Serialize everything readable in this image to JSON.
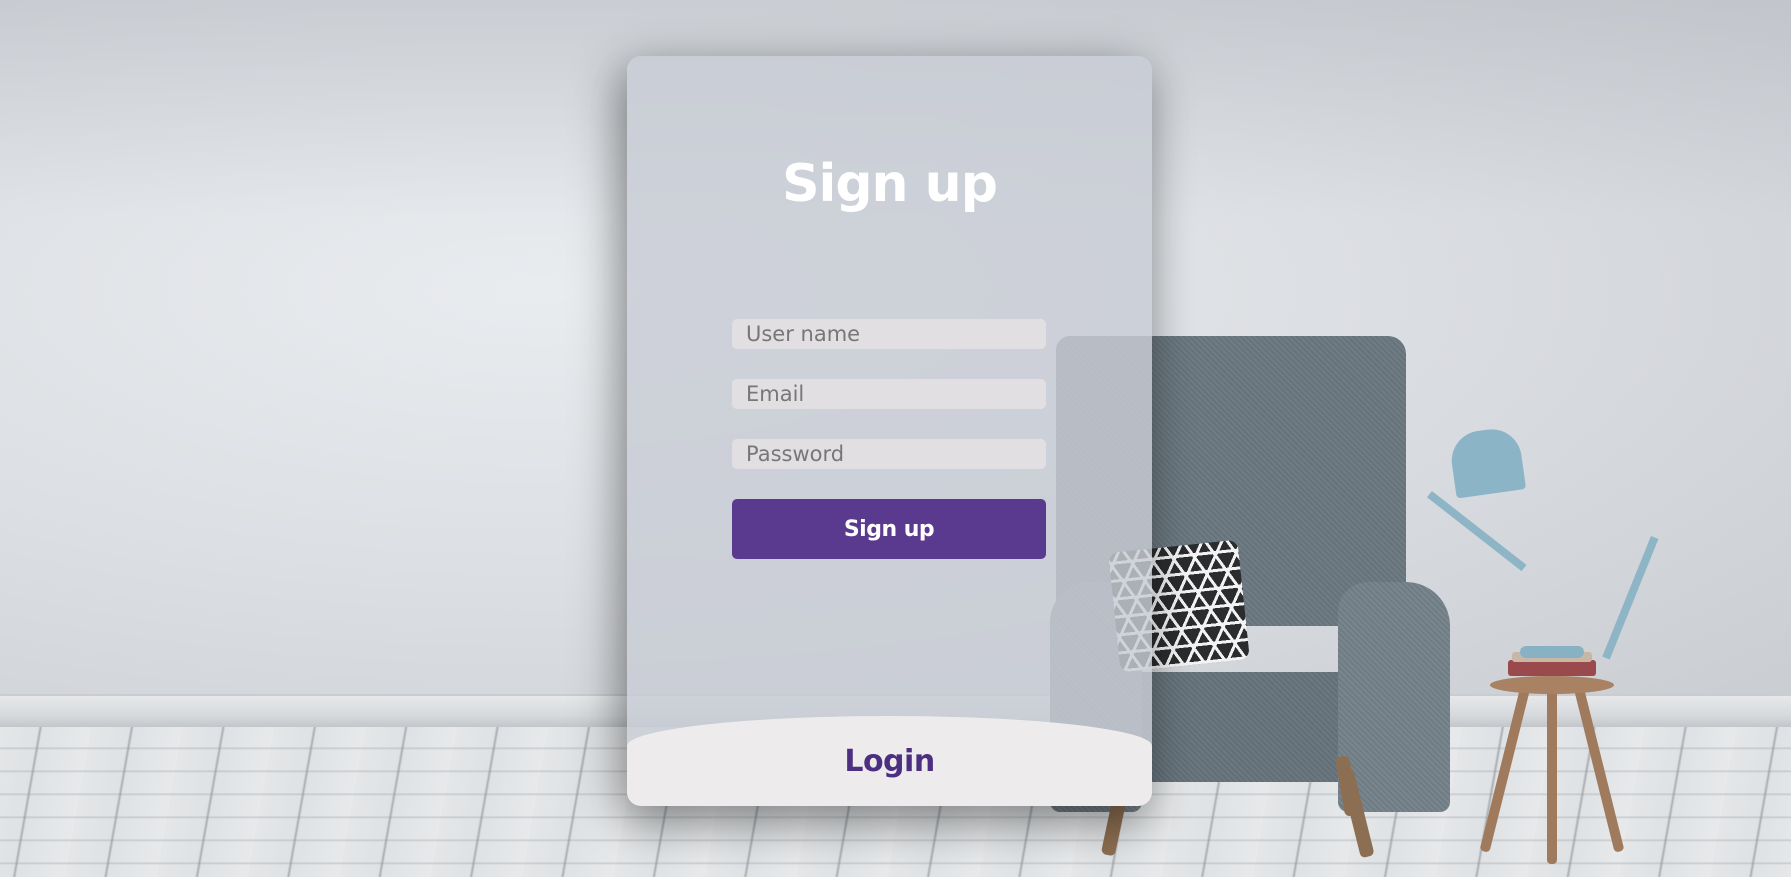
{
  "signup": {
    "title": "Sign up",
    "username_placeholder": "User name",
    "email_placeholder": "Email",
    "password_placeholder": "Password",
    "submit_label": "Sign up"
  },
  "login": {
    "label": "Login"
  },
  "colors": {
    "accent": "#5a3a8e",
    "login_text": "#4d2f82",
    "card_bg": "#c8ccd4",
    "field_bg": "#e1dfe1"
  }
}
